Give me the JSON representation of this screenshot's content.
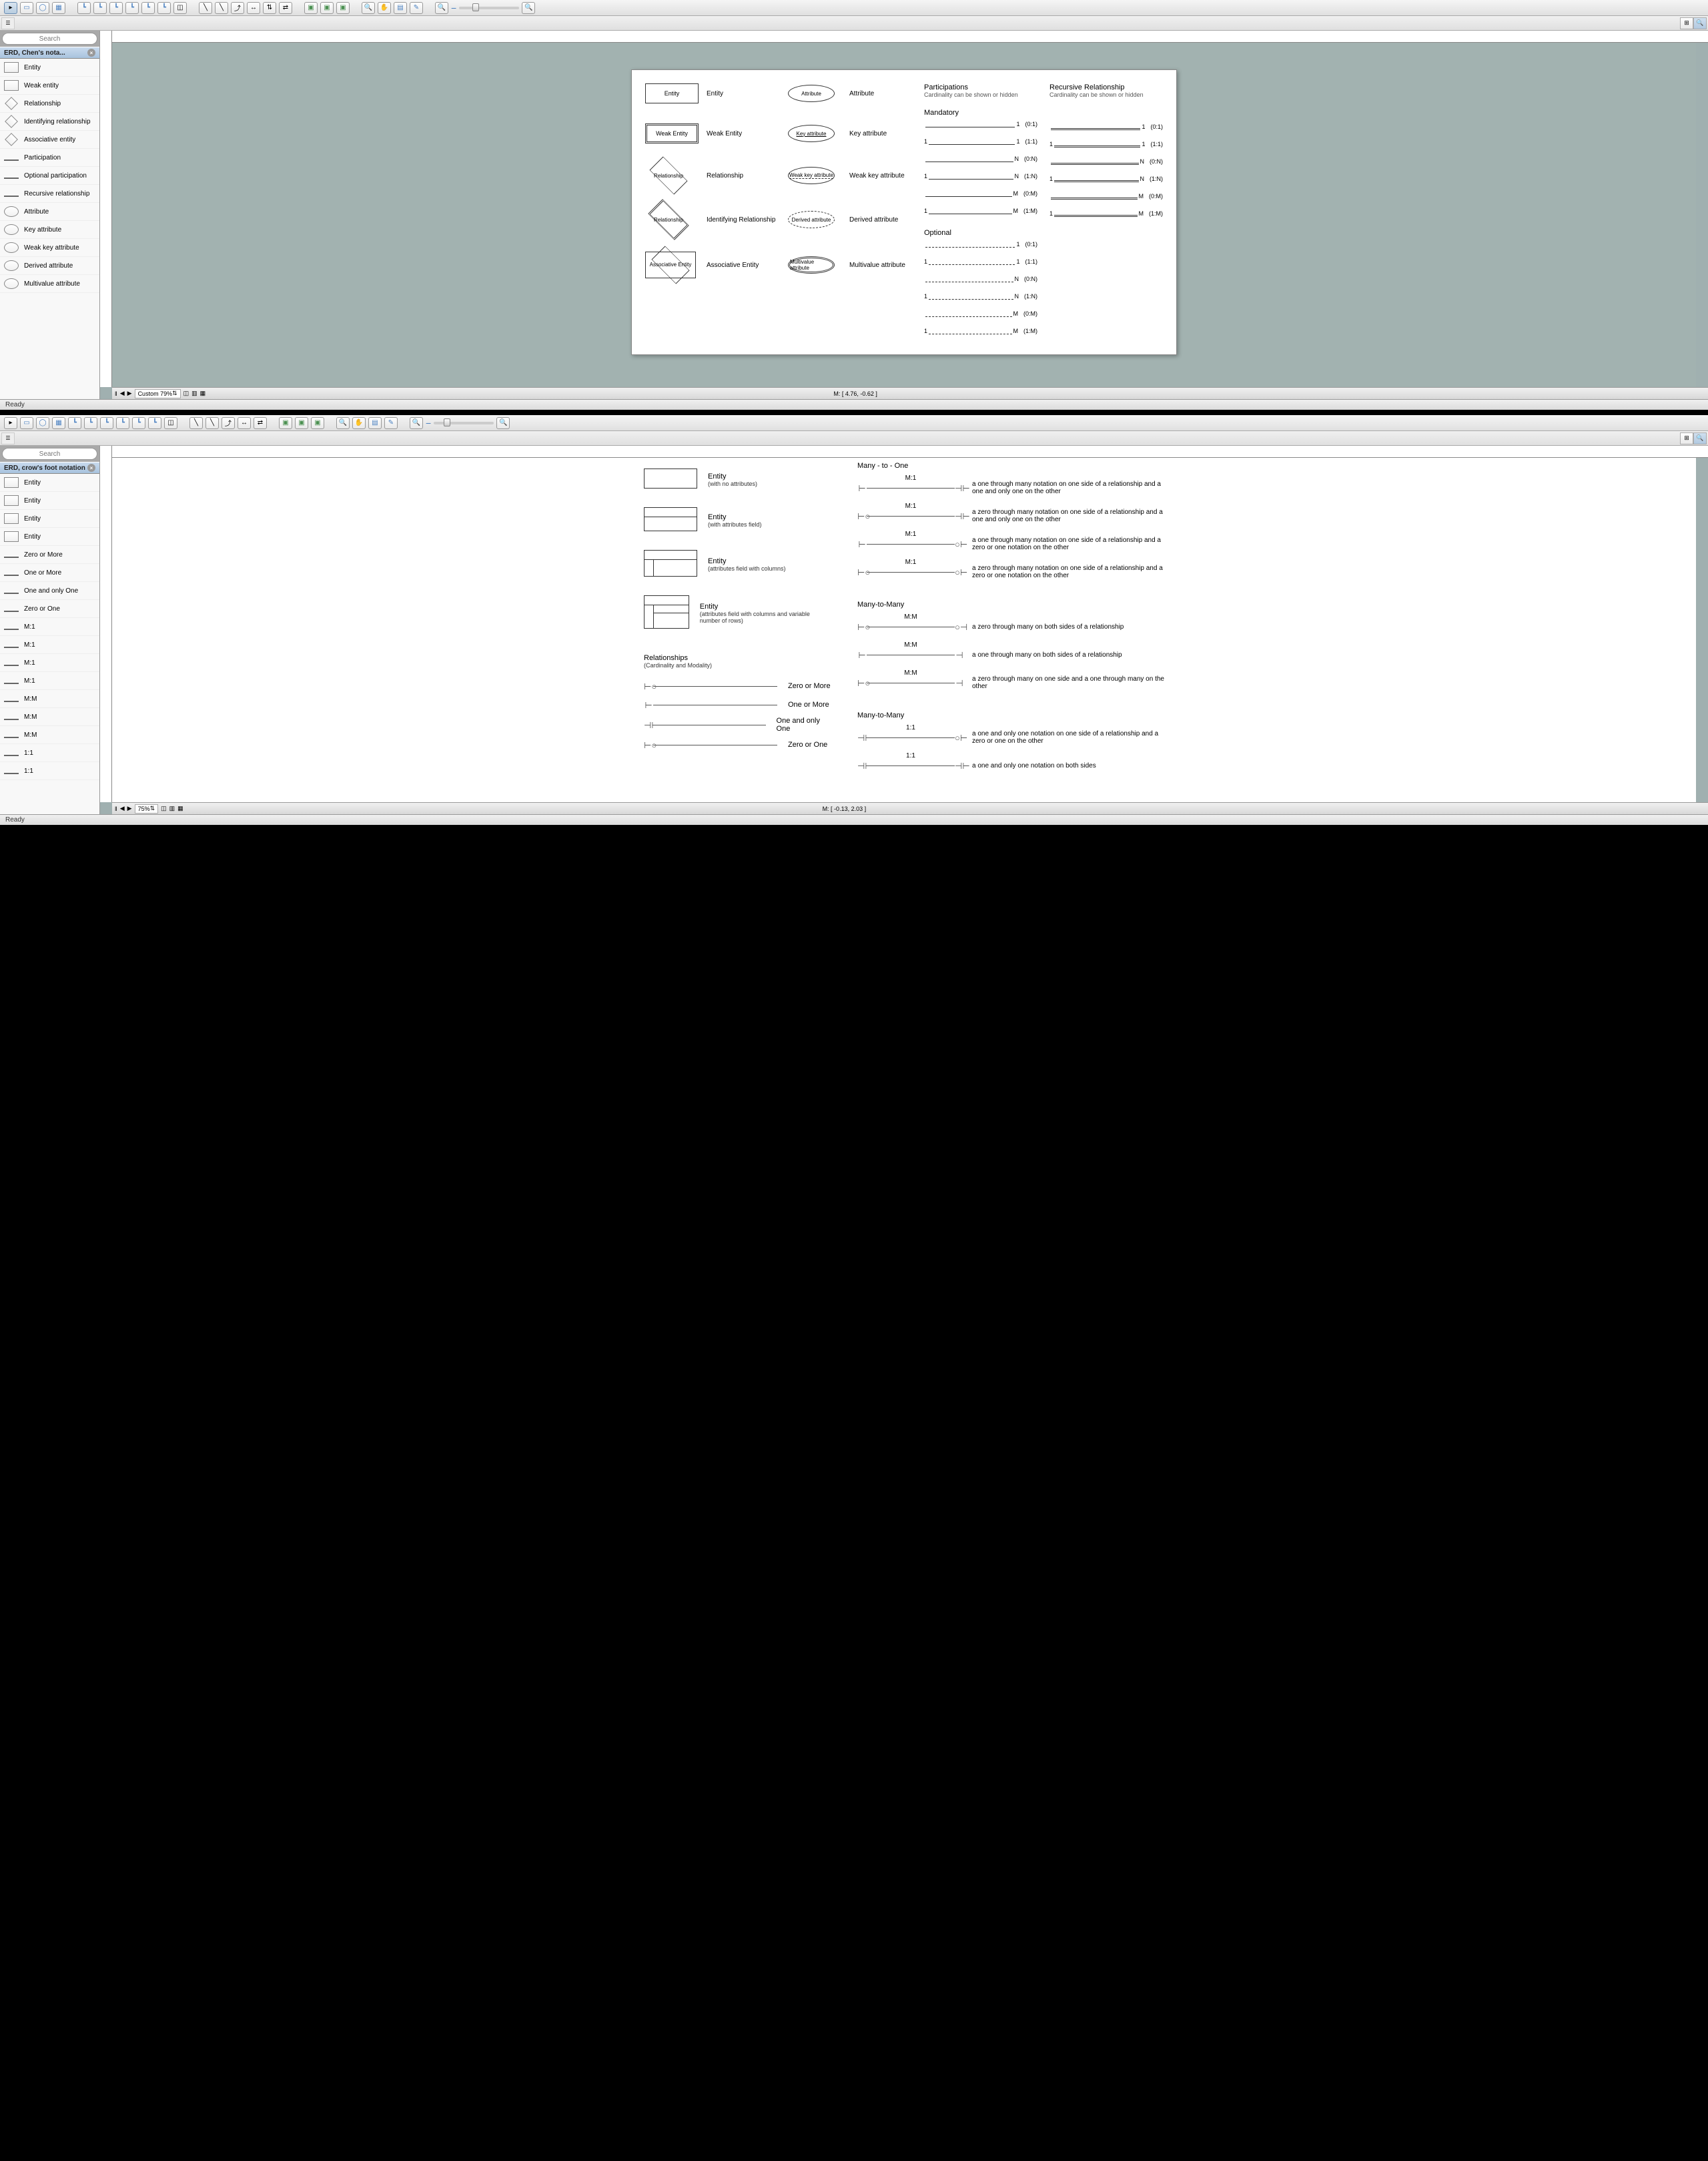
{
  "window1": {
    "search_placeholder": "Search",
    "panel_title": "ERD, Chen's nota...",
    "shapes": [
      {
        "label": "Entity"
      },
      {
        "label": "Weak entity"
      },
      {
        "label": "Relationship"
      },
      {
        "label": "Identifying relationship"
      },
      {
        "label": "Associative entity"
      },
      {
        "label": "Participation"
      },
      {
        "label": "Optional participation"
      },
      {
        "label": "Recursive relationship"
      },
      {
        "label": "Attribute"
      },
      {
        "label": "Key attribute"
      },
      {
        "label": "Weak key attribute"
      },
      {
        "label": "Derived attribute"
      },
      {
        "label": "Multivalue attribute"
      }
    ],
    "page": {
      "col_participations": "Participations",
      "col_part_sub": "Cardinality can be shown or hidden",
      "col_recursive": "Recursive Relationship",
      "col_recursive_sub": "Cardinality can be shown or hidden",
      "mandatory": "Mandatory",
      "optional": "Optional",
      "symbols": [
        {
          "shape": "Entity",
          "label": "Entity"
        },
        {
          "shape": "Attribute",
          "label": "Attribute"
        },
        {
          "shape": "Weak Entity",
          "label": "Weak Entity"
        },
        {
          "shape": "Key attribute",
          "label": "Key attribute"
        },
        {
          "shape": "Relationship",
          "label": "Relationship"
        },
        {
          "shape": "Weak key attribute",
          "label": "Weak key attribute"
        },
        {
          "shape": "Relationship",
          "label": "Identifying Relationship"
        },
        {
          "shape": "Derived attribute",
          "label": "Derived attribute"
        },
        {
          "shape": "Associative Entity",
          "label": "Associative Entity"
        },
        {
          "shape": "Multivalue attribute",
          "label": "Multivalue attribute"
        }
      ],
      "participations_mandatory": [
        {
          "left": "",
          "right": "1",
          "card": "(0:1)"
        },
        {
          "left": "1",
          "right": "1",
          "card": "(1:1)"
        },
        {
          "left": "",
          "right": "N",
          "card": "(0:N)"
        },
        {
          "left": "1",
          "right": "N",
          "card": "(1:N)"
        },
        {
          "left": "",
          "right": "M",
          "card": "(0:M)"
        },
        {
          "left": "1",
          "right": "M",
          "card": "(1:M)"
        }
      ],
      "participations_optional": [
        {
          "left": "",
          "right": "1",
          "card": "(0:1)"
        },
        {
          "left": "1",
          "right": "1",
          "card": "(1:1)"
        },
        {
          "left": "",
          "right": "N",
          "card": "(0:N)"
        },
        {
          "left": "1",
          "right": "N",
          "card": "(1:N)"
        },
        {
          "left": "",
          "right": "M",
          "card": "(0:M)"
        },
        {
          "left": "1",
          "right": "M",
          "card": "(1:M)"
        }
      ],
      "recursive": [
        {
          "left": "",
          "right": "1",
          "card": "(0:1)"
        },
        {
          "left": "1",
          "right": "1",
          "card": "(1:1)"
        },
        {
          "left": "",
          "right": "N",
          "card": "(0:N)"
        },
        {
          "left": "1",
          "right": "N",
          "card": "(1:N)"
        },
        {
          "left": "",
          "right": "M",
          "card": "(0:M)"
        },
        {
          "left": "1",
          "right": "M",
          "card": "(1:M)"
        }
      ]
    },
    "zoom_text": "Custom 79%",
    "mouse": "M: [ 4.76, -0.62 ]",
    "status": "Ready"
  },
  "window2": {
    "search_placeholder": "Search",
    "panel_title": "ERD, crow's foot notation",
    "shapes": [
      {
        "label": "Entity"
      },
      {
        "label": "Entity"
      },
      {
        "label": "Entity"
      },
      {
        "label": "Entity"
      },
      {
        "label": "Zero or More"
      },
      {
        "label": "One or More"
      },
      {
        "label": "One and only One"
      },
      {
        "label": "Zero or One"
      },
      {
        "label": "M:1"
      },
      {
        "label": "M:1"
      },
      {
        "label": "M:1"
      },
      {
        "label": "M:1"
      },
      {
        "label": "M:M"
      },
      {
        "label": "M:M"
      },
      {
        "label": "M:M"
      },
      {
        "label": "1:1"
      },
      {
        "label": "1:1"
      }
    ],
    "page": {
      "entities": [
        {
          "title": "Entity",
          "sub": "(with no attributes)"
        },
        {
          "title": "Entity",
          "sub": "(with attributes field)"
        },
        {
          "title": "Entity",
          "sub": "(attributes field with columns)"
        },
        {
          "title": "Entity",
          "sub": "(attributes field with columns and variable number of rows)"
        }
      ],
      "relationships_header": "Relationships",
      "relationships_sub": "(Cardinality and Modality)",
      "cardinality_lines": [
        {
          "label": "Zero or More"
        },
        {
          "label": "One or More"
        },
        {
          "label": "One and only One"
        },
        {
          "label": "Zero or One"
        }
      ],
      "sections": [
        {
          "title": "Many - to - One",
          "rows": [
            {
              "left": "⊢",
              "right": "⊣⊢",
              "label": "M:1",
              "desc": "a one through many notation on one side of a relationship and a one and only one on the other"
            },
            {
              "left": "⊢○",
              "right": "⊣⊢",
              "label": "M:1",
              "desc": "a zero through many notation on one side of a relationship and a one and only one on the other"
            },
            {
              "left": "⊢",
              "right": "○⊢",
              "label": "M:1",
              "desc": "a one through many notation on one side of a relationship and a zero or one notation on the other"
            },
            {
              "left": "⊢○",
              "right": "○⊢",
              "label": "M:1",
              "desc": "a zero through many notation on one side of a relationship and a zero or one notation on the other"
            }
          ]
        },
        {
          "title": "Many-to-Many",
          "rows": [
            {
              "left": "⊢○",
              "right": "○⊣",
              "label": "M:M",
              "desc": "a zero through many on both sides of a relationship"
            },
            {
              "left": "⊢",
              "right": "⊣",
              "label": "M:M",
              "desc": "a one through many on both sides of a relationship"
            },
            {
              "left": "⊢○",
              "right": "⊣",
              "label": "M:M",
              "desc": "a zero through many on one side and a one through many on the other"
            }
          ]
        },
        {
          "title": "Many-to-Many",
          "rows": [
            {
              "left": "⊣⊢",
              "right": "○⊢",
              "label": "1:1",
              "desc": "a one and only one notation on one side of a relationship and a zero or one on the other"
            },
            {
              "left": "⊣⊢",
              "right": "⊣⊢",
              "label": "1:1",
              "desc": "a one and only one notation on both sides"
            }
          ]
        }
      ]
    },
    "zoom_text": "75%",
    "mouse": "M: [ -0.13, 2.03 ]",
    "status": "Ready"
  }
}
